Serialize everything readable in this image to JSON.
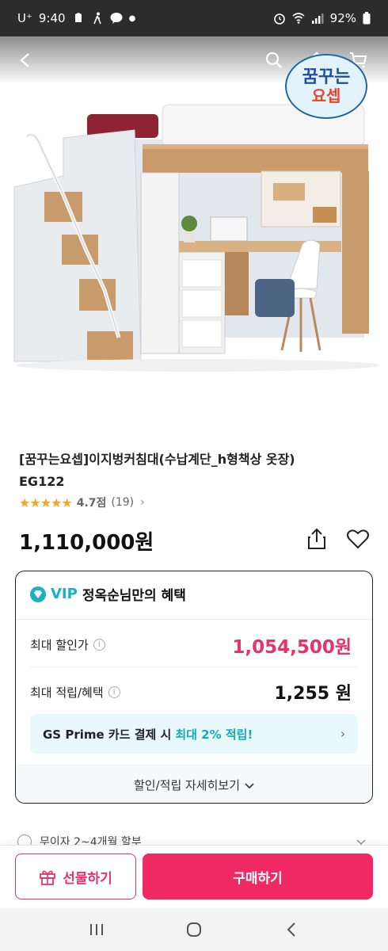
{
  "status_bar": {
    "carrier": "U⁺",
    "time": "9:40",
    "battery": "92%"
  },
  "brand_logo": {
    "line1": "꿈꾸는",
    "line2": "요셉"
  },
  "product": {
    "title_line1": "[꿈꾸는요셉]이지벙커침대(수납계단_h형책상 옷장)",
    "title_line2": "EG122",
    "stars": "★★★★★",
    "rating_score": "4.7점",
    "rating_count": "(19)",
    "rating_arrow": "›",
    "price": "1,110,000원"
  },
  "benefit": {
    "vip_label": "VIP",
    "header_text": "정옥순님만의 혜택",
    "max_discount_label": "최대 할인가",
    "max_discount_value": "1,054,500원",
    "max_reward_label": "최대 적립/혜택",
    "max_reward_value": "1,255 원",
    "gs_text": "GS Prime 카드 결제 시",
    "gs_highlight": "최대 2% 적립!",
    "gs_arrow": "›",
    "detail_link": "할인/적립 자세히보기"
  },
  "partial_row": {
    "text": "무이자 2~4개월 할부"
  },
  "actions": {
    "gift_label": "선물하기",
    "buy_label": "구매하기"
  },
  "colors": {
    "accent_pink": "#ef2a63",
    "vip_teal": "#1bb1c3",
    "star": "#f5a623"
  }
}
